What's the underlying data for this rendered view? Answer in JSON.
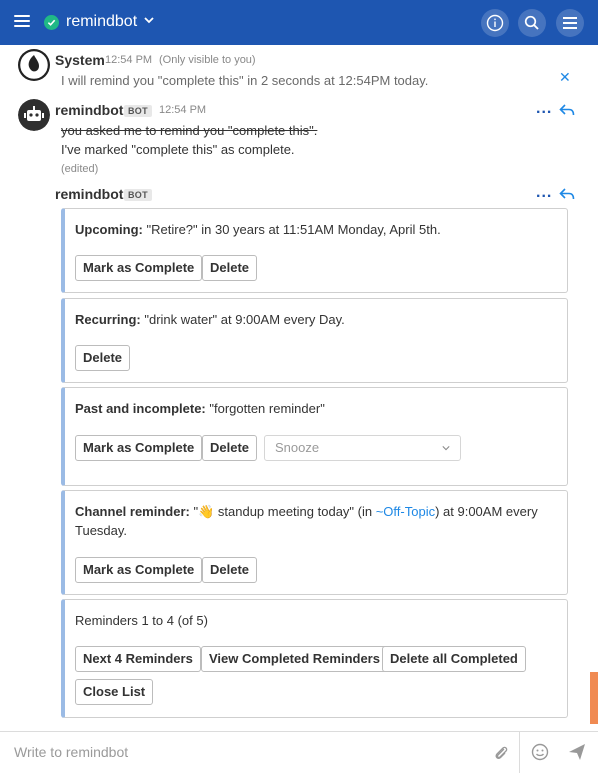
{
  "header": {
    "channel": "remindbot",
    "icons": [
      "menu-icon",
      "online-check-icon",
      "chevron-down-icon",
      "info-icon",
      "search-icon",
      "more-menu-icon"
    ]
  },
  "system_post": {
    "username": "System",
    "time": "12:54 PM",
    "note": "(Only visible to you)",
    "message": "I will remind you \"complete this\" in 2 seconds at 12:54PM today."
  },
  "bot_post": {
    "username": "remindbot",
    "bot_tag": "BOT",
    "time": "12:54 PM",
    "struck_message": "you asked me to remind you \"complete this\".",
    "message": "I've marked \"complete this\" as complete.",
    "edited": "(edited)",
    "dots": "..."
  },
  "list_post": {
    "username": "remindbot",
    "bot_tag": "BOT",
    "dots": "...",
    "cards": {
      "upcoming": {
        "label": "Upcoming:",
        "text": " \"Retire?\" in 30 years at 11:51AM Monday, April 5th.",
        "complete": "Mark as Complete",
        "delete": "Delete"
      },
      "recurring": {
        "label": "Recurring:",
        "text": " \"drink water\" at 9:00AM every Day.",
        "delete": "Delete"
      },
      "past": {
        "label": "Past and incomplete:",
        "text": " \"forgotten reminder\"",
        "complete": "Mark as Complete",
        "delete": "Delete",
        "snooze": "Snooze"
      },
      "channel": {
        "label": "Channel reminder:",
        "text_a": " \"",
        "emoji": "👋",
        "text_b": " standup meeting today\" (in ",
        "link": "~Off-Topic",
        "text_c": ") at 9:00AM every",
        "text_d": "Tuesday.",
        "complete": "Mark as Complete",
        "delete": "Delete"
      },
      "summary": {
        "text": "Reminders 1 to 4 (of 5)",
        "next": "Next 4 Reminders",
        "view_completed": "View Completed Reminders",
        "delete_all": "Delete all Completed",
        "close": "Close List"
      }
    }
  },
  "footer": {
    "placeholder": "Write to remindbot"
  },
  "colors": {
    "header": "#1e56b1",
    "accent_link": "#1e88e5",
    "card_border": "#9bbbe5",
    "online": "#20b986",
    "scroll_accent": "#f08a52"
  }
}
